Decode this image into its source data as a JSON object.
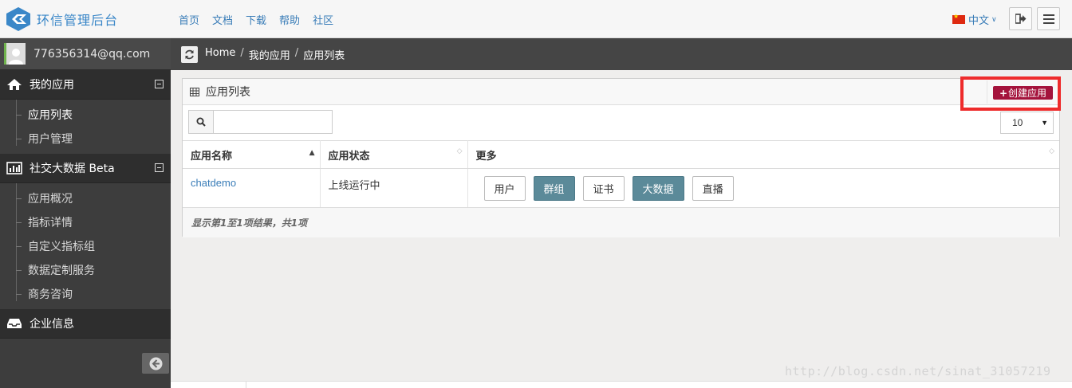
{
  "brand": {
    "title": "环信管理后台"
  },
  "topnav": {
    "items": [
      "首页",
      "文档",
      "下载",
      "帮助",
      "社区"
    ]
  },
  "lang": {
    "label": "中文"
  },
  "sidebar": {
    "user": "776356314@qq.com",
    "groups": [
      {
        "title": "我的应用",
        "icon": "home-icon",
        "items": [
          "应用列表",
          "用户管理"
        ]
      },
      {
        "title": "社交大数据 Beta",
        "icon": "bar-chart-icon",
        "items": [
          "应用概况",
          "指标详情",
          "自定义指标组",
          "数据定制服务",
          "商务咨询"
        ]
      },
      {
        "title": "企业信息",
        "icon": "inbox-icon",
        "items": []
      }
    ]
  },
  "breadcrumb": {
    "items": [
      "Home",
      "我的应用",
      "应用列表"
    ],
    "separator": "/"
  },
  "panel": {
    "title": "应用列表",
    "create_button": "创建应用",
    "search": {
      "value": "",
      "placeholder": ""
    },
    "page_size": "10",
    "columns": [
      "应用名称",
      "应用状态",
      "更多"
    ],
    "rows": [
      {
        "name": "chatdemo",
        "status": "上线运行中",
        "actions": [
          "用户",
          "群组",
          "证书",
          "大数据",
          "直播"
        ]
      }
    ],
    "footer": "显示第1至1项结果，共1项"
  },
  "watermark": "http://blog.csdn.net/sinat_31057219",
  "colors": {
    "brand": "#3a87c8",
    "create_button": "#a4133c",
    "highlight": "#ee2b2b",
    "action_blue": "#5b8a99"
  }
}
